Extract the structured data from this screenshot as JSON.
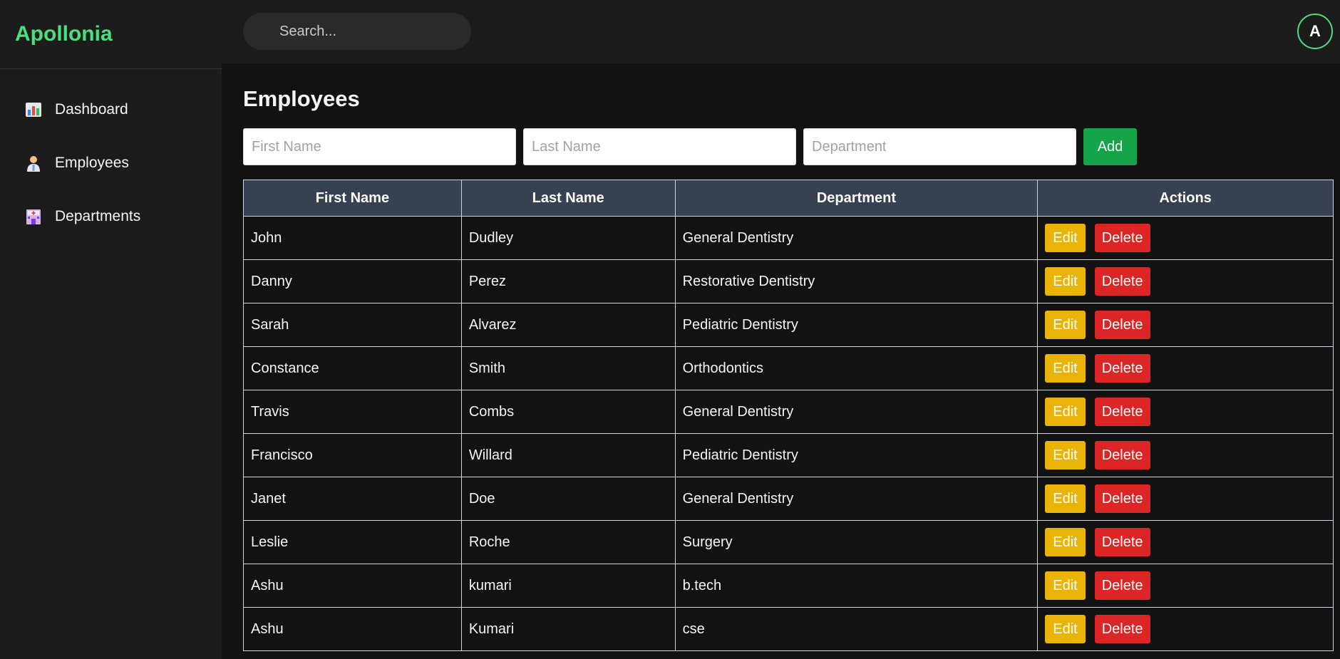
{
  "brand": "Apollonia",
  "search": {
    "placeholder": "Search..."
  },
  "avatar": {
    "initial": "A"
  },
  "sidebar": {
    "items": [
      {
        "label": "Dashboard",
        "icon": "bar-chart-icon"
      },
      {
        "label": "Employees",
        "icon": "doctor-icon"
      },
      {
        "label": "Departments",
        "icon": "hospital-icon"
      }
    ]
  },
  "page": {
    "title": "Employees"
  },
  "form": {
    "first_placeholder": "First Name",
    "last_placeholder": "Last Name",
    "dept_placeholder": "Department",
    "add_label": "Add"
  },
  "table": {
    "headers": [
      "First Name",
      "Last Name",
      "Department",
      "Actions"
    ],
    "edit_label": "Edit",
    "delete_label": "Delete",
    "rows": [
      {
        "first": "John",
        "last": "Dudley",
        "dept": "General Dentistry"
      },
      {
        "first": "Danny",
        "last": "Perez",
        "dept": "Restorative Dentistry"
      },
      {
        "first": "Sarah",
        "last": "Alvarez",
        "dept": "Pediatric Dentistry"
      },
      {
        "first": "Constance",
        "last": "Smith",
        "dept": "Orthodontics"
      },
      {
        "first": "Travis",
        "last": "Combs",
        "dept": "General Dentistry"
      },
      {
        "first": "Francisco",
        "last": "Willard",
        "dept": "Pediatric Dentistry"
      },
      {
        "first": "Janet",
        "last": "Doe",
        "dept": "General Dentistry"
      },
      {
        "first": "Leslie",
        "last": "Roche",
        "dept": "Surgery"
      },
      {
        "first": "Ashu",
        "last": "kumari",
        "dept": "b.tech"
      },
      {
        "first": "Ashu",
        "last": "Kumari",
        "dept": "cse"
      }
    ]
  },
  "colors": {
    "brand": "#4ade80",
    "add": "#16a34a",
    "edit": "#eab308",
    "delete": "#dc2626",
    "header": "#374151"
  }
}
